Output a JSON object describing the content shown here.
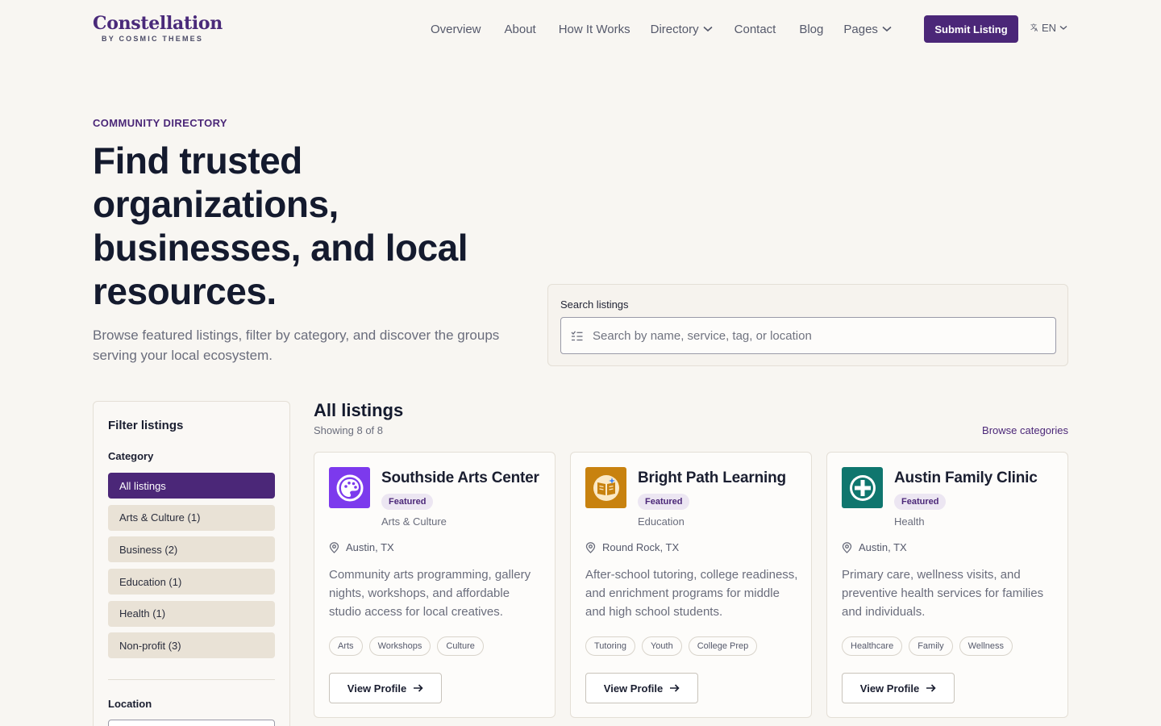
{
  "brand": {
    "title": "Constellation",
    "subtitle": "BY COSMIC THEMES"
  },
  "nav": {
    "items": [
      {
        "label": "Overview"
      },
      {
        "label": "About"
      },
      {
        "label": "How It Works"
      },
      {
        "label": "Directory",
        "has_dropdown": true
      },
      {
        "label": "Contact"
      },
      {
        "label": "Blog"
      },
      {
        "label": "Pages",
        "has_dropdown": true
      }
    ],
    "submit_label": "Submit Listing",
    "language": "EN"
  },
  "hero": {
    "eyebrow": "COMMUNITY DIRECTORY",
    "title": "Find trusted organizations, businesses, and local resources.",
    "subtitle": "Browse featured listings, filter by category, and discover the groups serving your local ecosystem."
  },
  "search": {
    "label": "Search listings",
    "placeholder": "Search by name, service, tag, or location",
    "value": ""
  },
  "sidebar": {
    "title": "Filter listings",
    "category_heading": "Category",
    "categories": [
      {
        "label": "All listings",
        "active": true
      },
      {
        "label": "Arts & Culture (1)",
        "active": false
      },
      {
        "label": "Business (2)",
        "active": false
      },
      {
        "label": "Education (1)",
        "active": false
      },
      {
        "label": "Health (1)",
        "active": false
      },
      {
        "label": "Non-profit (3)",
        "active": false
      }
    ],
    "location_heading": "Location"
  },
  "listings": {
    "title": "All listings",
    "count_text": "Showing 8 of 8",
    "browse_label": "Browse categories",
    "cards": [
      {
        "name": "Southside Arts Center",
        "badge": "Featured",
        "category": "Arts & Culture",
        "location": "Austin, TX",
        "description": "Community arts programming, gallery nights, workshops, and affordable studio access for local creatives.",
        "tags": [
          "Arts",
          "Workshops",
          "Culture"
        ],
        "button": "View Profile",
        "icon": "palette-icon",
        "icon_color": "#7c3aed"
      },
      {
        "name": "Bright Path Learning",
        "badge": "Featured",
        "category": "Education",
        "location": "Round Rock, TX",
        "description": "After-school tutoring, college readiness, and enrichment programs for middle and high school students.",
        "tags": [
          "Tutoring",
          "Youth",
          "College Prep"
        ],
        "button": "View Profile",
        "icon": "book-icon",
        "icon_color": "#c8820f"
      },
      {
        "name": "Austin Family Clinic",
        "badge": "Featured",
        "category": "Health",
        "location": "Austin, TX",
        "description": "Primary care, wellness visits, and preventive health services for families and individuals.",
        "tags": [
          "Healthcare",
          "Family",
          "Wellness"
        ],
        "button": "View Profile",
        "icon": "medical-cross-icon",
        "icon_color": "#0f766e"
      }
    ]
  },
  "colors": {
    "brand": "#4b2778",
    "background": "#f8f6f2",
    "chip": "#e9e2d6"
  }
}
